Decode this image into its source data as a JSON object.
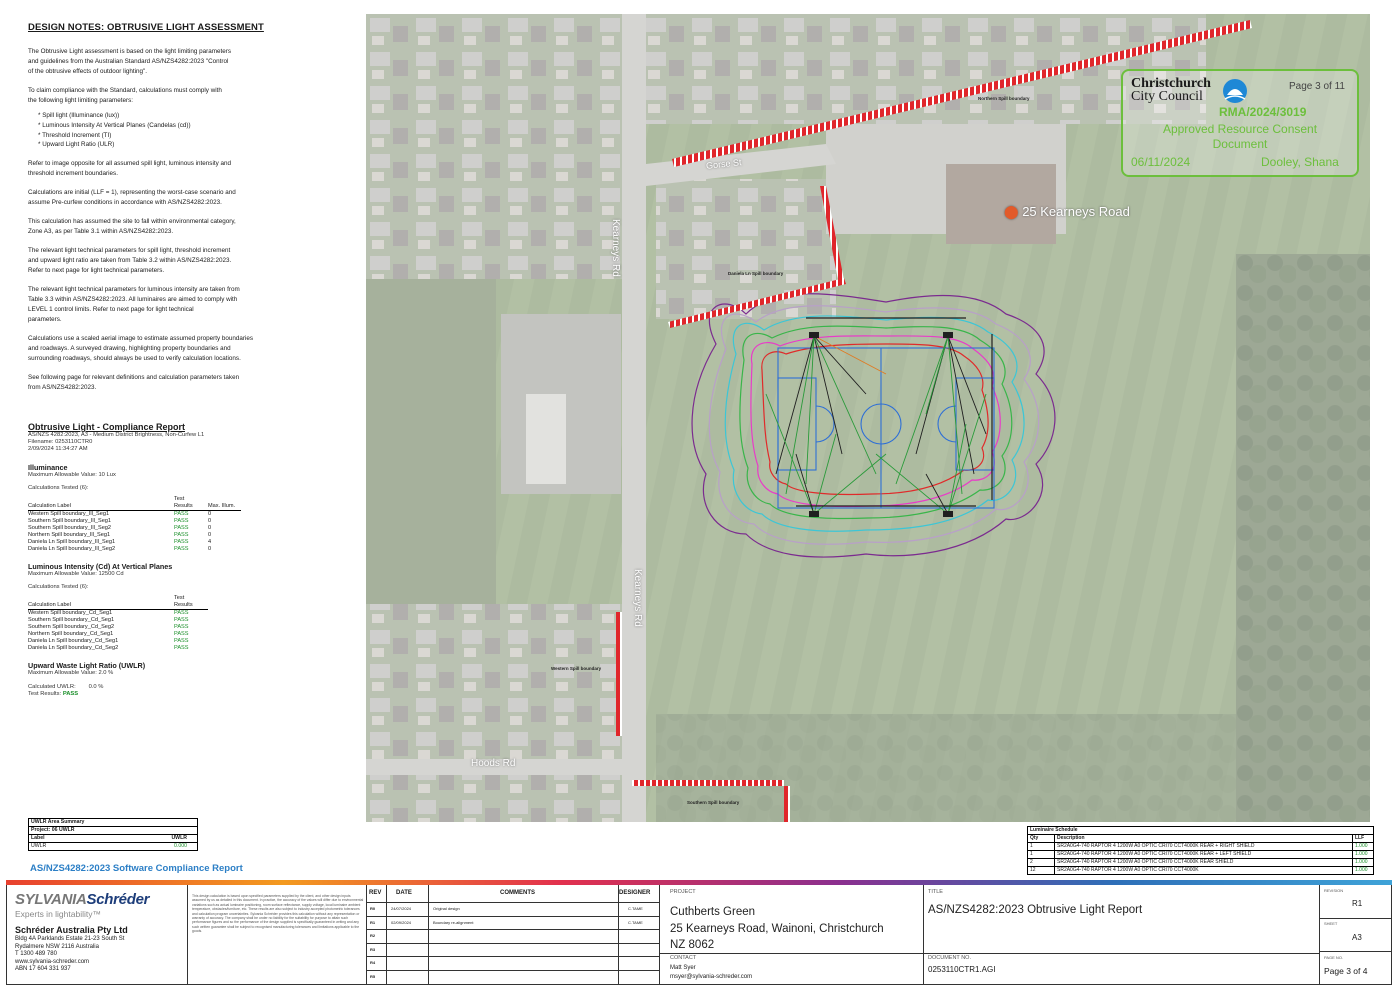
{
  "notes": {
    "heading": "DESIGN NOTES: OBTRUSIVE LIGHT ASSESSMENT",
    "p1": "The Obtrusive Light assessment is based on the light limiting parameters\nand guidelines from the Australian Standard AS/NZS4282:2023 \"Control\nof the obtrusive effects of outdoor lighting\".",
    "p2": "To claim compliance with the Standard, calculations must comply with\nthe following light limiting parameters:",
    "bullets": [
      "* Spill light (Illuminance (lux))",
      "* Luminous Intensity At Vertical Planes (Candelas (cd))",
      "* Threshold Increment (TI)",
      "* Upward Light Ratio (ULR)"
    ],
    "p3": "Refer to image opposite for all assumed spill light, luminous intensity and\nthreshold increment boundaries.",
    "p4": "Calculations are initial (LLF = 1), representing the worst-case scenario and\nassume Pre-curfew conditions in accordance with AS/NZS4282:2023.",
    "p5": "This calculation has assumed the site to fall within environmental category,\nZone A3, as per Table 3.1 within AS/NZS4282:2023.",
    "p6": "The relevant light technical parameters for spill light, threshold increment\nand upward light ratio are taken from Table 3.2 within AS/NZS4282:2023.\nRefer to next page for light technical parameters.",
    "p7": "The relevant light technical parameters for luminous intensity are taken from\nTable 3.3 within AS/NZS4282:2023. All luminaires are aimed to comply with\nLEVEL 1 control limits. Refer to next page for light technical\nparameters.",
    "p8": "Calculations use a scaled aerial image to estimate assumed property boundaries\nand roadways. A surveyed drawing, highlighting property boundaries and\nsurrounding roadways, should always be used to verify calculation locations.",
    "p9": "See following page for relevant definitions and calculation parameters taken\nfrom AS/NZS4282:2023."
  },
  "report": {
    "title": "Obtrusive Light - Compliance Report",
    "line1": "AS/NZS 4282:2023, A3 - Medium District Brightness, Non-Curfew L1",
    "line2": "Filename: 0253110CTR0",
    "line3": "2/09/2024 11:34:27 AM",
    "illum_heading": "Illuminance",
    "illum_max": "Maximum Allowable Value: 10 Lux",
    "illum_tested": "Calculations Tested (6):",
    "col_label": "Calculation Label",
    "col_test": "Test Results",
    "col_max": "Max. Illum.",
    "illum_rows": [
      {
        "label": "Western Spill boundary_Ill_Seg1",
        "result": "PASS",
        "max": "0"
      },
      {
        "label": "Southern Spill boundary_Ill_Seg1",
        "result": "PASS",
        "max": "0"
      },
      {
        "label": "Southern Spill boundary_Ill_Seg2",
        "result": "PASS",
        "max": "0"
      },
      {
        "label": "Northern Spill boundary_Ill_Seg1",
        "result": "PASS",
        "max": "0"
      },
      {
        "label": "Daniela Ln Spill boundary_Ill_Seg1",
        "result": "PASS",
        "max": "4"
      },
      {
        "label": "Daniela Ln Spill boundary_Ill_Seg2",
        "result": "PASS",
        "max": "0"
      }
    ],
    "cd_heading": "Luminous Intensity (Cd) At Vertical Planes",
    "cd_max": "Maximum Allowable Value: 12500 Cd",
    "cd_tested": "Calculations Tested (6):",
    "cd_rows": [
      {
        "label": "Western Spill boundary_Cd_Seg1",
        "result": "PASS"
      },
      {
        "label": "Southern Spill boundary_Cd_Seg1",
        "result": "PASS"
      },
      {
        "label": "Southern Spill boundary_Cd_Seg2",
        "result": "PASS"
      },
      {
        "label": "Northern Spill boundary_Cd_Seg1",
        "result": "PASS"
      },
      {
        "label": "Daniela Ln Spill boundary_Cd_Seg1",
        "result": "PASS"
      },
      {
        "label": "Daniela Ln Spill boundary_Cd_Seg2",
        "result": "PASS"
      }
    ],
    "uwlr_heading": "Upward Waste Light Ratio (UWLR)",
    "uwlr_max": "Maximum Allowable Value: 2.0 %",
    "uwlr_calc_label": "Calculated UWLR:",
    "uwlr_calc_value": "0.0 %",
    "uwlr_test_label": "Test Results:",
    "uwlr_test_value": "PASS"
  },
  "uwlr_box": {
    "title": "UWLR Area Summary",
    "project": "Project: 06 UWLR",
    "col_label": "Label",
    "col_value": "UWLR",
    "row_label": "UWLR",
    "row_value": "0.000"
  },
  "software_report": "AS/NZS4282:2023 Software Compliance Report",
  "map": {
    "road_label_1": "25 Kearneys Road",
    "road_label_2": "Kearneys Rd",
    "road_label_3": "Kearneys Rd",
    "road_label_4": "Gorse St",
    "road_label_5": "Hoods Rd",
    "northern": "Northern Spill boundary",
    "daniela": "Daniela Ln Spill boundary",
    "western": "Western Spill boundary",
    "southern": "Southern Spill boundary"
  },
  "stamp": {
    "council_line1": "Christchurch",
    "council_line2": "City Council",
    "page": "Page 3 of 11",
    "rma": "RMA/2024/3019",
    "approved1": "Approved Resource Consent",
    "approved2": "Document",
    "date": "06/11/2024",
    "officer": "Dooley, Shana",
    "green": "#6cbf3c",
    "blue": "#1e88d6"
  },
  "luminaires": {
    "title": "Luminaire Schedule",
    "col_qty": "Qty",
    "col_desc": "Description",
    "col_llf": "LLF",
    "rows": [
      {
        "qty": "1",
        "desc": "SR2A0G4-740 RAPTOR 4 1200W A0 OPTIC CRI70 CCT4000K REAR + RIGHT SHIELD",
        "llf": "1.000"
      },
      {
        "qty": "1",
        "desc": "SR2A0G4-740 RAPTOR 4 1200W A0 OPTIC CRI70 CCT4000K REAR + LEFT SHIELD",
        "llf": "1.000"
      },
      {
        "qty": "2",
        "desc": "SR2A0G4-740 RAPTOR 4 1200W A0 OPTIC CRI70 CCT4000K REAR SHIELD",
        "llf": "1.000"
      },
      {
        "qty": "12",
        "desc": "SR2A0G4-740 RAPTOR 4 1200W A0 OPTIC CRI70 CCT4000K",
        "llf": "1.000"
      }
    ]
  },
  "titleblock": {
    "brand_a": "SYLVANIA",
    "brand_b": "Schréder",
    "tagline": "Experts in lightability™",
    "company": "Schréder Australia Pty Ltd",
    "addr1": "Bldg 4A Parklands Estate 21-23 South St",
    "addr2": "Rydalmere NSW 2116 Australia",
    "phone": "T 1300 489 780",
    "web": "www.sylvania-schreder.com",
    "abn": "ABN 17 604 331 937",
    "disclaimer": "This design calculation is based upon specified parameters supplied by the client, and other design inputs assumed by us as detailed in this document. In practice, the accuracy of the values will differ due to environmental variations such as actual luminaire positioning, room surface reflectance, supply voltage, local luminaire ambient temperature, obstacles/furniture, etc. These results are also subject to industry accepted photometric tolerances and calculation program uncertainties. Sylvania Schréder provides this calculation without any representation or warranty of accuracy. The company shall be under no liability for the suitability for purpose to attain such performance figures and so the performance of the design supplied is specifically guaranteed in writing and any such written guarantee shall be subject to recognised manufacturing tolerances and limitations applicable to the goods.",
    "rev_h": "REV",
    "date_h": "DATE",
    "comments_h": "COMMENTS",
    "designer_h": "DESIGNER",
    "revs": [
      {
        "rev": "R0",
        "date": "24/07/2024",
        "comment": "Original design",
        "designer": "C.TAME"
      },
      {
        "rev": "R1",
        "date": "02/09/2024",
        "comment": "Boundary re-alignment",
        "designer": "C.TAME"
      },
      {
        "rev": "R2",
        "date": "",
        "comment": "",
        "designer": ""
      },
      {
        "rev": "R3",
        "date": "",
        "comment": "",
        "designer": ""
      },
      {
        "rev": "R4",
        "date": "",
        "comment": "",
        "designer": ""
      },
      {
        "rev": "R5",
        "date": "",
        "comment": "",
        "designer": ""
      }
    ],
    "project_h": "PROJECT",
    "project_1": "Cuthberts Green",
    "project_2": "25 Kearneys Road, Wainoni, Christchurch",
    "project_3": "NZ 8062",
    "contact_h": "CONTACT",
    "contact_name": "Matt Syer",
    "contact_email": "msyer@sylvania-schreder.com",
    "title_h": "TITLE",
    "title": "AS/NZS4282:2023 Obtrusive Light Report",
    "doc_h": "DOCUMENT NO.",
    "doc": "0253110CTR1.AGI",
    "revision_h": "REVISION",
    "revision": "R1",
    "sheet_h": "SHEET",
    "sheet": "A3",
    "page_h": "PAGE NO.",
    "page": "Page 3 of 4"
  }
}
